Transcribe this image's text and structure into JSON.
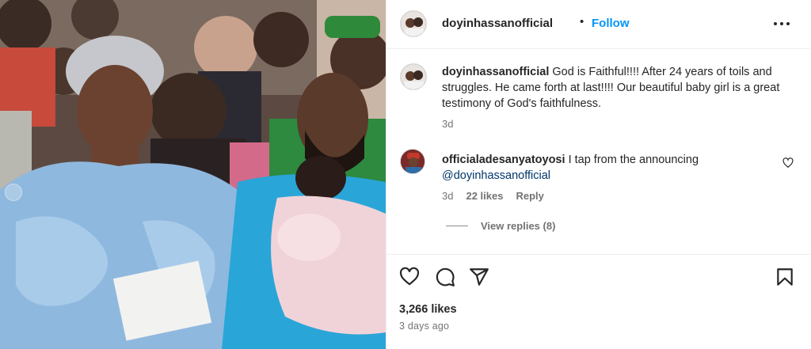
{
  "post": {
    "author": "doyinhassanofficial",
    "follow_label": "Follow",
    "separator": "•",
    "more_icon": "more-horizontal-icon"
  },
  "caption": {
    "username": "doyinhassanofficial",
    "text": "God is Faithful!!!! After 24 years of toils and struggles. He came forth at last!!!! Our beautiful baby girl is a great testimony of God's faithfulness.",
    "time": "3d"
  },
  "comments": [
    {
      "username": "officialadesanyatoyosi",
      "text": "I tap from the announcing",
      "mention": "@doyinhassanofficial",
      "time": "3d",
      "likes": "22 likes",
      "reply_label": "Reply",
      "view_replies": "View replies (8)"
    }
  ],
  "actions": {
    "like_icon": "heart-icon",
    "comment_icon": "comment-icon",
    "share_icon": "send-icon",
    "save_icon": "bookmark-icon"
  },
  "likes_count": "3,266 likes",
  "posted": "3 days ago",
  "colors": {
    "accent": "#0095f6",
    "mention": "#00376b",
    "text": "#262626",
    "muted": "#737373"
  }
}
